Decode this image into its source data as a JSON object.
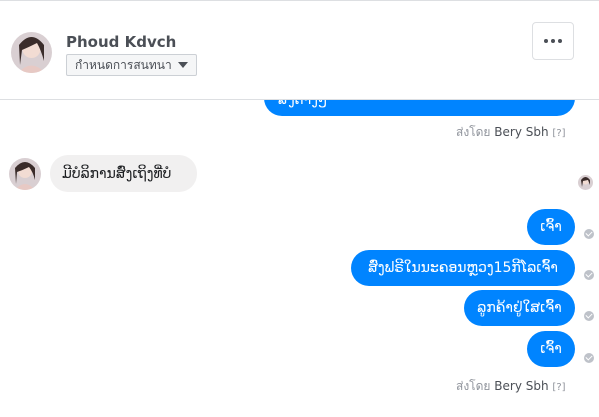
{
  "header": {
    "contact_name": "Phoud Kdvch",
    "conversation_button_label": "กำหนดการสนทนา",
    "more_button_icon": "more-horizontal-icon"
  },
  "thread": {
    "top_partial_message": "ສົ່ງຕາງໆ",
    "sent_by_1": {
      "prefix": "ส่งโดย",
      "name": "Bery Sbh",
      "help": "[?]"
    },
    "incoming_message": "ມີບໍລິການສົ່ງເຖິງທີ່ບໍ",
    "outgoing_messages": [
      "ເຈົ້າ",
      "ສົ່ງຟຣີໃນນະຄອນຫຼວງ15ກີໂລເຈົ້າ",
      "ລູກຄ້າຢູ່ໃສເຈົ້າ",
      "ເຈົ້າ"
    ],
    "sent_by_2": {
      "prefix": "ส่งโดย",
      "name": "Bery Sbh",
      "help": "[?]"
    }
  },
  "colors": {
    "outgoing_bubble": "#0084ff",
    "incoming_bubble": "#f1f0f0",
    "meta_text": "#90949c"
  }
}
